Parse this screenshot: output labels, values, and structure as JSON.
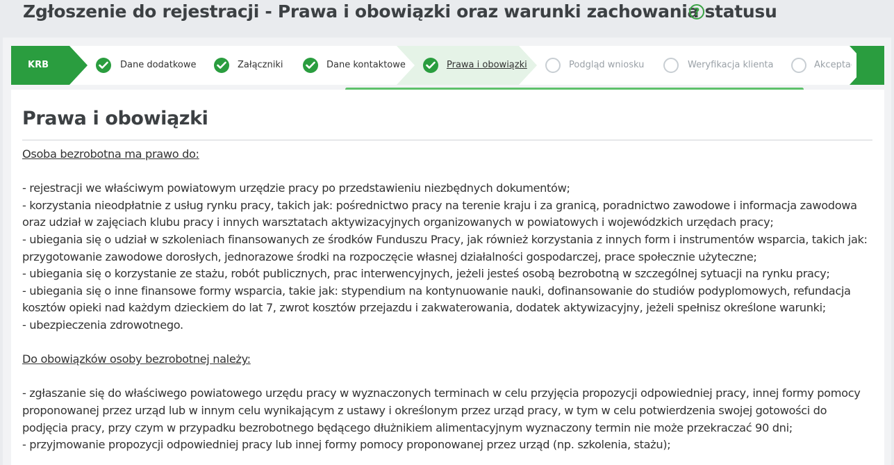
{
  "page": {
    "title": "Zgłoszenie do rejestracji - Prawa i obowiązki oraz warunki zachowania statusu",
    "help_symbol": "?"
  },
  "stepper": {
    "first": "KRB",
    "steps": [
      {
        "label": "Dane dodatkowe",
        "state": "done"
      },
      {
        "label": "Załączniki",
        "state": "done"
      },
      {
        "label": "Dane kontaktowe",
        "state": "done"
      },
      {
        "label": "Prawa i obowiązki",
        "state": "current"
      },
      {
        "label": "Podgląd wniosku",
        "state": "pending"
      },
      {
        "label": "Weryfikacja klienta",
        "state": "pending"
      },
      {
        "label": "Akceptacja",
        "state": "pending"
      }
    ],
    "progress_fraction": 0.52
  },
  "section": {
    "heading": "Prawa i obowiązki",
    "rights_heading": "Osoba bezrobotna ma prawo do:",
    "rights": [
      "- rejestracji we właściwym powiatowym urzędzie pracy po przedstawieniu niezbędnych dokumentów;",
      "- korzystania nieodpłatnie z usług rynku pracy, takich jak: pośrednictwo pracy na terenie kraju i za granicą, poradnictwo zawodowe i informacja zawodowa oraz udział w zajęciach klubu pracy i innych warsztatach aktywizacyjnych organizowanych w powiatowych i wojewódzkich urzędach pracy;",
      "- ubiegania się o udział w szkoleniach finansowanych ze środków Funduszu Pracy, jak również korzystania z innych form i instrumentów wsparcia, takich jak: przygotowanie zawodowe dorosłych, jednorazowe środki na rozpoczęcie własnej działalności gospodarczej, prace społecznie użyteczne;",
      "- ubiegania się o korzystanie ze stażu, robót publicznych, prac interwencyjnych, jeżeli jesteś osobą bezrobotną w szczególnej sytuacji na rynku pracy;",
      "- ubiegania się o inne finansowe formy wsparcia, takie jak: stypendium na kontynuowanie nauki, dofinansowanie do studiów podyplomowych, refundacja kosztów opieki nad każdym dzieckiem do lat 7, zwrot kosztów przejazdu i zakwaterowania, dodatek aktywizacyjny, jeżeli spełnisz określone warunki;",
      "- ubezpieczenia zdrowotnego."
    ],
    "duties_heading": "Do obowiązków osoby bezrobotnej należy:",
    "duties": [
      "- zgłaszanie się do właściwego powiatowego urzędu pracy w wyznaczonych terminach w celu przyjęcia propozycji odpowiedniej pracy, innej formy pomocy proponowanej przez urząd lub w innym celu wynikającym z ustawy i określonym przez urząd pracy, w tym w celu potwierdzenia swojej gotowości do podjęcia pracy, przy czym w przypadku bezrobotnego będącego dłużnikiem alimentacyjnym wyznaczony termin nie może przekraczać 90 dni;",
      "- przyjmowanie propozycji odpowiedniej pracy lub innej formy pomocy proponowanej przez urząd (np. szkolenia, stażu);"
    ]
  }
}
